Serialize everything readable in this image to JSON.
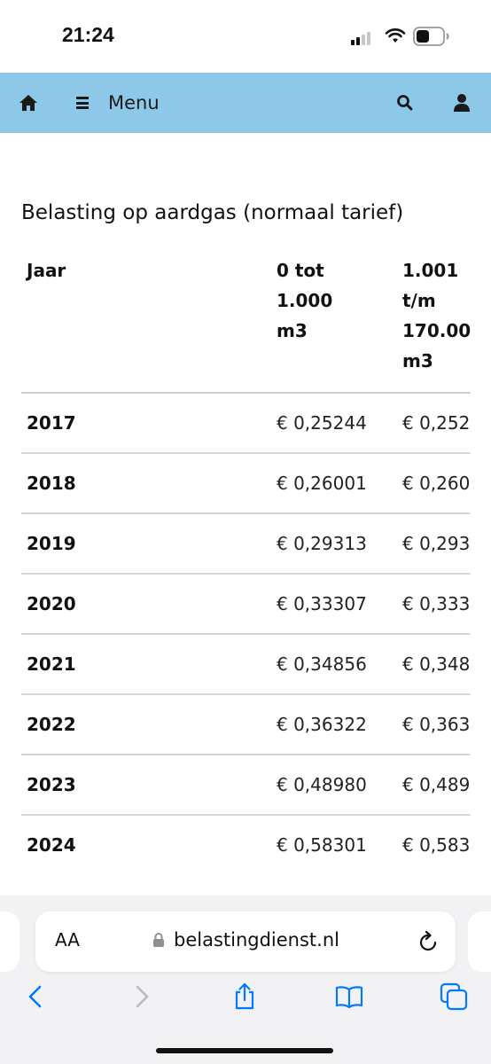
{
  "status_bar": {
    "time": "21:24"
  },
  "navbar": {
    "menu_label": "Menu",
    "icons": [
      "home-icon",
      "menu-icon",
      "search-icon",
      "user-icon"
    ],
    "background": "#8ec8e8"
  },
  "page": {
    "title": "Belasting op aardgas (normaal tarief)",
    "table": {
      "headers": {
        "year": "Jaar",
        "col_a": [
          "0 tot",
          "1.000",
          "m3"
        ],
        "col_b": [
          "1.001",
          "t/m",
          "170.00",
          "m3"
        ]
      },
      "rows": [
        {
          "year": "2017",
          "a": "€ 0,25244",
          "b": "€ 0,252"
        },
        {
          "year": "2018",
          "a": "€ 0,26001",
          "b": "€ 0,260"
        },
        {
          "year": "2019",
          "a": "€ 0,29313",
          "b": "€ 0,293"
        },
        {
          "year": "2020",
          "a": "€ 0,33307",
          "b": "€ 0,333"
        },
        {
          "year": "2021",
          "a": "€ 0,34856",
          "b": "€ 0,348"
        },
        {
          "year": "2022",
          "a": "€ 0,36322",
          "b": "€ 0,363"
        },
        {
          "year": "2023",
          "a": "€ 0,48980",
          "b": "€ 0,489"
        },
        {
          "year": "2024",
          "a": "€ 0,58301",
          "b": "€ 0,583"
        }
      ]
    }
  },
  "browser": {
    "aa_label": "AA",
    "url": "belastingdienst.nl",
    "toolbar_icons": [
      "back-icon",
      "forward-icon",
      "share-icon",
      "bookmarks-icon",
      "tabs-icon"
    ],
    "accent": "#007aff"
  }
}
